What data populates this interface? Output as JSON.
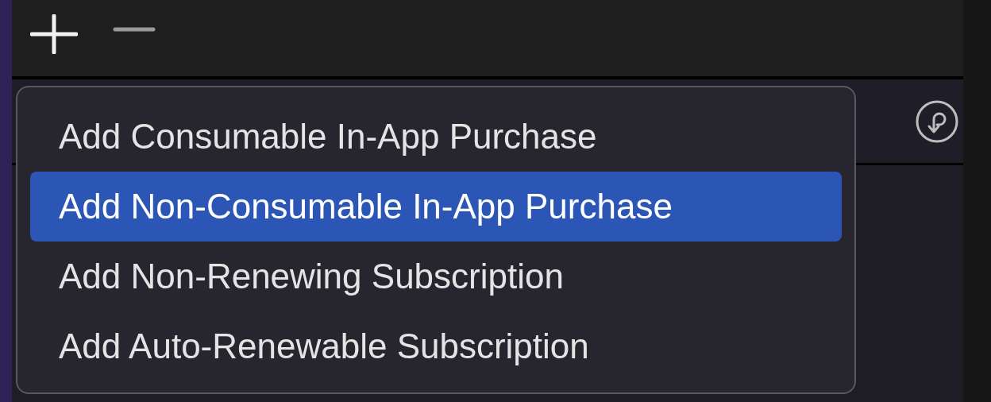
{
  "menu": {
    "items": [
      {
        "label": "Add Consumable In-App Purchase",
        "selected": false
      },
      {
        "label": "Add Non-Consumable In-App Purchase",
        "selected": true
      },
      {
        "label": "Add Non-Renewing Subscription",
        "selected": false
      },
      {
        "label": "Add Auto-Renewable Subscription",
        "selected": false
      }
    ]
  }
}
